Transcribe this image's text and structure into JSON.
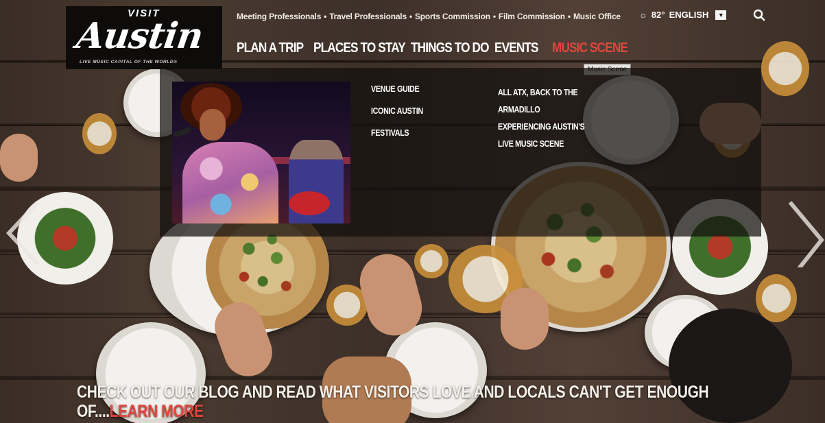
{
  "logo": {
    "visit": "VISIT",
    "austin": "Austin",
    "tagline": "LIVE MUSIC CAPITAL OF THE WORLD®"
  },
  "utility_nav": {
    "items": [
      "Meeting Professionals",
      "Travel Professionals",
      "Sports Commission",
      "Film Commission",
      "Music Office"
    ],
    "separator": "•"
  },
  "weather": {
    "icon": "sun-icon",
    "temperature": "82°"
  },
  "language": {
    "selected": "ENGLISH"
  },
  "search": {
    "icon": "search-icon"
  },
  "main_nav": {
    "items": [
      {
        "label": "PLAN A TRIP"
      },
      {
        "label": "PLACES TO STAY"
      },
      {
        "label": "THINGS TO DO"
      },
      {
        "label": "EVENTS"
      },
      {
        "label": "MUSIC SCENE",
        "active": true
      }
    ],
    "tooltip": "Music Scene"
  },
  "dropdown": {
    "column1": [
      "VENUE GUIDE",
      "ICONIC AUSTIN",
      "FESTIVALS"
    ],
    "column2": [
      [
        "ALL ATX, BACK TO THE",
        "ARMADILLO"
      ],
      [
        "EXPERIENCING AUSTIN'S",
        "LIVE MUSIC SCENE"
      ]
    ]
  },
  "hero": {
    "headline_line1": "CHECK OUT OUR BLOG AND READ WHAT VISITORS LOVE AND LOCALS CAN'T GET ENOUGH",
    "headline_line2_prefix": "OF....",
    "learn_more": "LEARN MORE"
  },
  "colors": {
    "accent": "#e2453c",
    "header_bg": "#0e0c0b",
    "text": "#ffffff"
  }
}
